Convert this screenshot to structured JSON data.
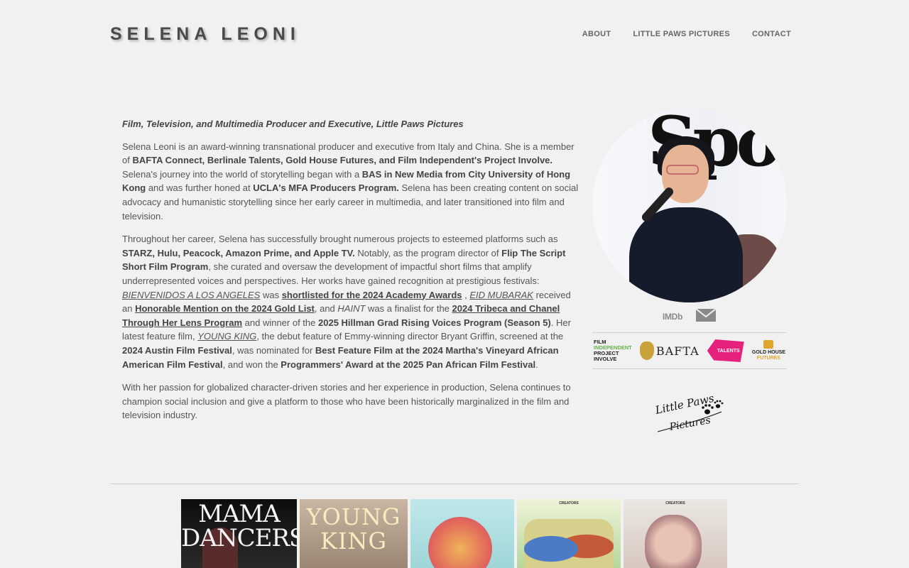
{
  "header": {
    "site_title": "SELENA LEONI",
    "nav": [
      "ABOUT",
      "LITTLE PAWS PICTURES",
      "CONTACT"
    ]
  },
  "bio": {
    "role": "Film, Television, and Multimedia Producer and Executive, Little Paws Pictures",
    "p1": {
      "s1": "Selena Leoni is an award-winning transnational producer and executive from Italy and China. She is a member of ",
      "b1": "BAFTA Connect, Berlinale Talents, Gold House Futures, and Film Independent's Project Involve.",
      "s2": " Selena's journey into the world of storytelling began with a ",
      "b2": "BAS in New Media from City University of Hong Kong",
      "s3": " and was further honed at ",
      "b3": "UCLA's MFA Producers Program.",
      "s4": " Selena has been creating content on social advocacy and humanistic storytelling since her early career in multimedia, and later transitioned into film and television."
    },
    "p2": {
      "s1": "Throughout her career, Selena has successfully brought numerous projects to esteemed platforms such as ",
      "b1": "STARZ, Hulu, Peacock, Amazon Prime, and Apple TV.",
      "s2": " Notably, as the program director of ",
      "b2": "Flip The Script Short Film Program",
      "s3": ", she curated and oversaw the development of impactful short films that amplify underrepresented voices and perspectives. Her works have gained recognition at prestigious festivals: ",
      "i1": "BIENVENIDOS A LOS ANGELES",
      "s4": " was ",
      "u1": "shortlisted for the 2024 Academy Awards",
      "s5": " , ",
      "i2": "EID MUBARAK",
      "s6": " received an ",
      "u2": "Honorable Mention on the 2024 Gold List",
      "s7": ", and ",
      "i3": "HAINT",
      "s8": " was a finalist for the ",
      "u3": "2024 Tribeca and Chanel Through Her Lens Program",
      "s9": " and winner of the ",
      "b3": "2025 Hillman Grad Rising Voices Program (Season 5)",
      "s10": ". Her latest feature film, ",
      "i4": "YOUNG KING",
      "s11": ", the debut feature of Emmy-winning director Bryant Griffin, screened at the ",
      "b4": "2024 Austin Film Festival",
      "s12": ", was nominated for ",
      "b5": "Best Feature Film at the 2024 Martha's Vineyard African American Film Festival",
      "s13": ", and won the ",
      "b6": "Programmers' Award at the 2025 Pan African Film Festival",
      "s14": "."
    },
    "p3": "With her passion for globalized character-driven stories and her experience in production, Selena continues to champion social inclusion and give a platform to those who have been historically marginalized in the film and television industry."
  },
  "sidebar": {
    "portrait_text": "Spot",
    "imdb": "IMDb",
    "logos": {
      "fi_line1": "FILM",
      "fi_line2": "INDEPENDENT",
      "fi_line3": "PROJECT",
      "fi_line4": "INVOLVE",
      "bafta": "BAFTA",
      "talents": "TALENTS",
      "gh_line1": "GOLD HOUSE",
      "gh_line2": "FUTURES"
    },
    "company_logo_text": "Little Paws Pictures"
  },
  "posters": {
    "p1": "MAMA DANCERS",
    "p2": "YOUNG KING",
    "p4_mini": "CREATORS",
    "p5_mini": "CREATORS"
  },
  "colors": {
    "background": "#f1f1f1",
    "text": "#555555",
    "fi_green": "#62b34a",
    "talents_pink": "#e6227d",
    "gold": "#e0a52a"
  }
}
